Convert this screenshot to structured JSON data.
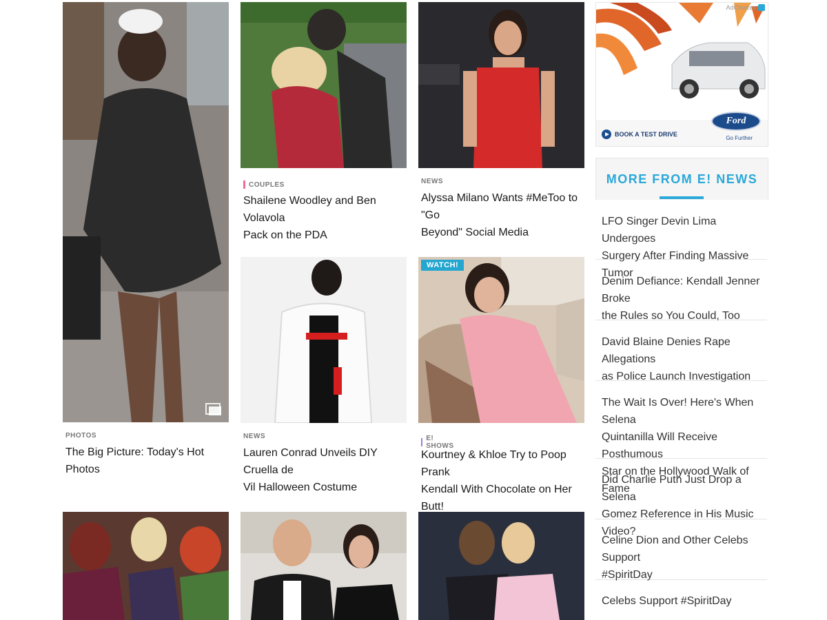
{
  "cards": [
    {
      "category": "PHOTOS",
      "title_lines": [
        "The Big Picture: Today's Hot Photos"
      ]
    },
    {
      "category": "COUPLES",
      "title_lines": [
        "Shailene Woodley and Ben Volavola",
        "Pack on the PDA"
      ]
    },
    {
      "category": "NEWS",
      "title_lines": [
        "Alyssa Milano Wants #MeToo to \"Go",
        "Beyond\" Social Media"
      ]
    },
    {
      "category": "NEWS",
      "title_lines": [
        "Lauren Conrad Unveils DIY Cruella de",
        "Vil Halloween Costume"
      ]
    },
    {
      "category": "E! SHOWS",
      "title_lines": [
        "Kourtney & Khloe Try to Poop Prank",
        "Kendall With Chocolate on Her Butt!"
      ],
      "badge": "WATCH!"
    }
  ],
  "ad": {
    "adchoices": "AdChoices",
    "cta": "BOOK A TEST DRIVE",
    "brand": "Ford",
    "tagline": "Go Further"
  },
  "sidebar": {
    "heading": "MORE FROM E! NEWS",
    "items": [
      {
        "lines": [
          "LFO Singer Devin Lima Undergoes",
          "Surgery After Finding Massive Tumor"
        ]
      },
      {
        "lines": [
          "Denim Defiance: Kendall Jenner Broke",
          "the Rules so You Could, Too"
        ]
      },
      {
        "lines": [
          "David Blaine Denies Rape Allegations",
          "as Police Launch Investigation"
        ]
      },
      {
        "lines": [
          "The Wait Is Over! Here's When Selena",
          "Quintanilla Will Receive Posthumous",
          "Star on the Hollywood Walk of Fame"
        ]
      },
      {
        "lines": [
          "Did Charlie Puth Just Drop a Selena",
          "Gomez Reference in His Music Video?"
        ]
      },
      {
        "lines": [
          "Celine Dion and Other Celebs Support",
          "#SpiritDay"
        ]
      },
      {
        "lines": [
          "Celebs Support #SpiritDay"
        ]
      }
    ]
  },
  "colors": {
    "accent": "#2aa8d9",
    "couples_bar": "#f06a9b",
    "shows_bar": "#9a7fd6"
  }
}
